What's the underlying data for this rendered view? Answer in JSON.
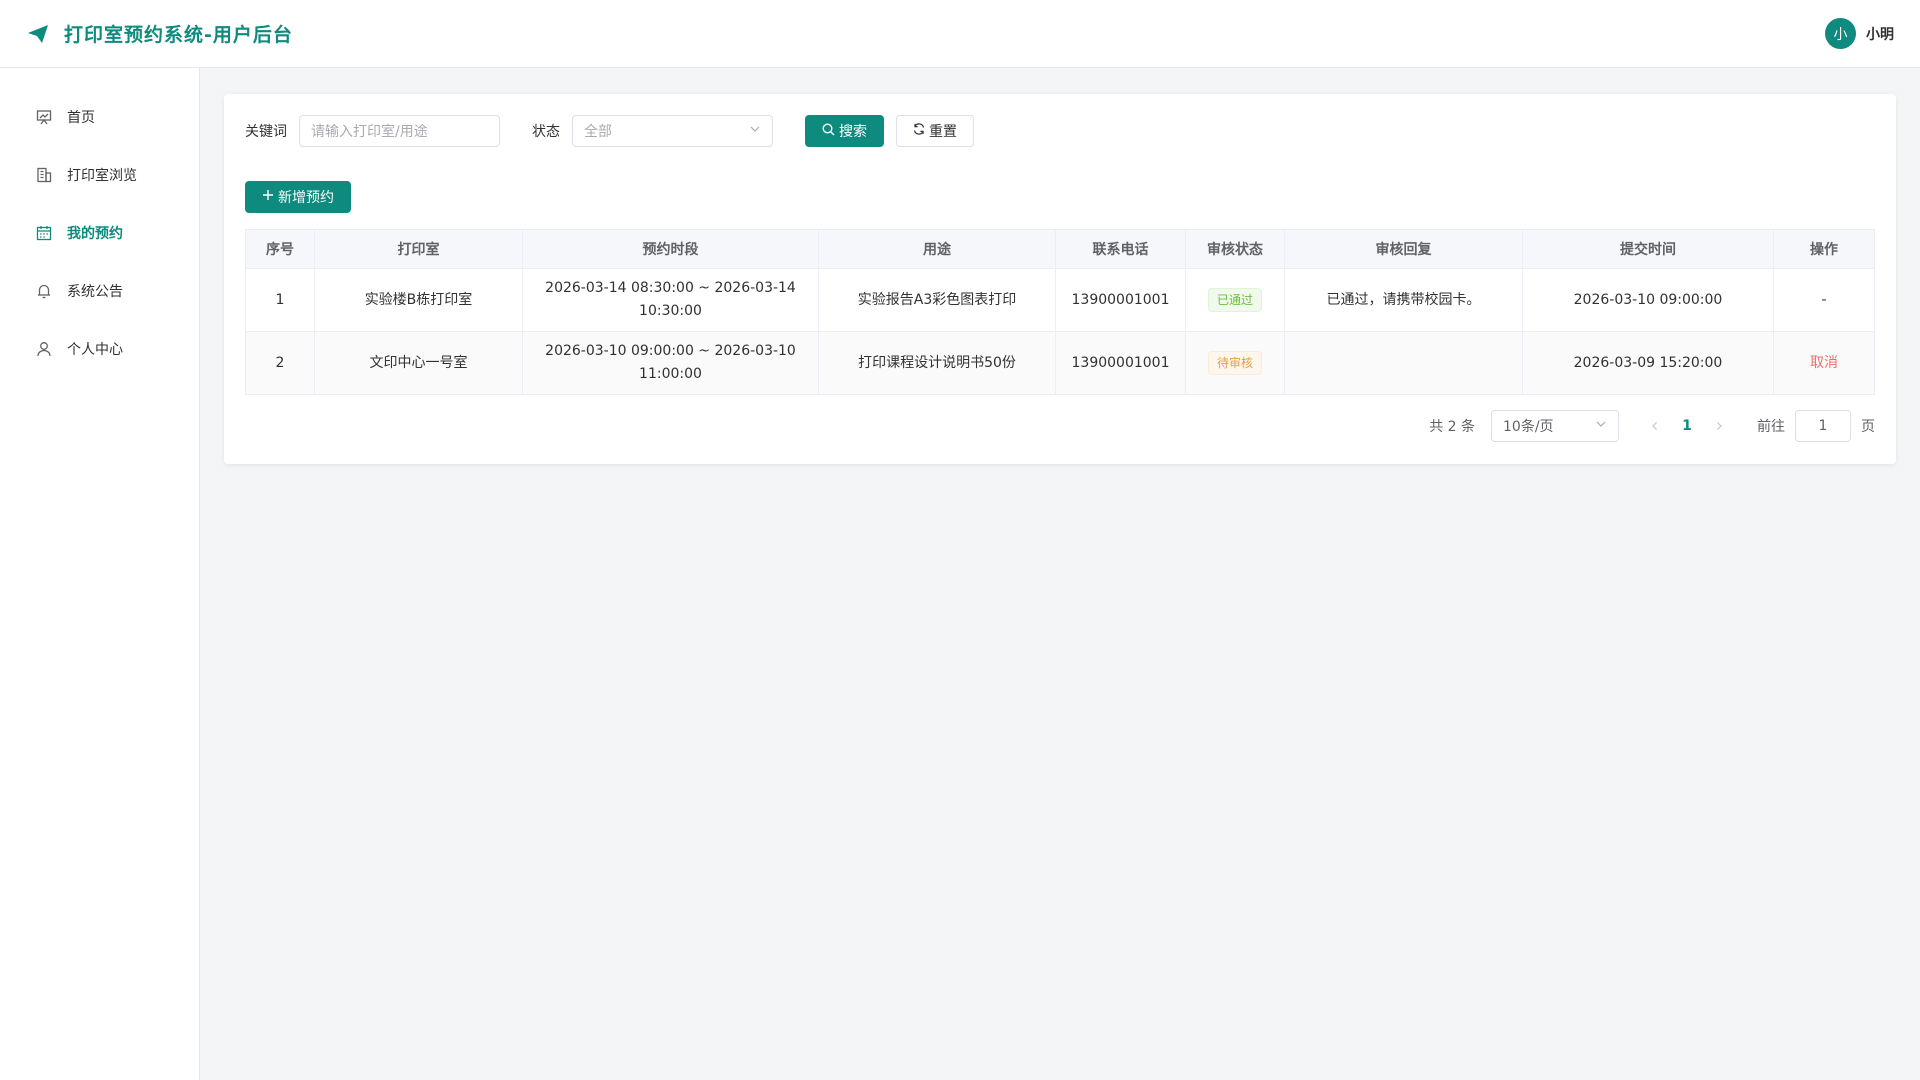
{
  "header": {
    "title": "打印室预约系统-用户后台",
    "avatar_text": "小",
    "username": "小明"
  },
  "sidebar": {
    "items": [
      {
        "label": "首页",
        "icon": "dashboard-icon",
        "active": false
      },
      {
        "label": "打印室浏览",
        "icon": "building-icon",
        "active": false
      },
      {
        "label": "我的预约",
        "icon": "calendar-icon",
        "active": true
      },
      {
        "label": "系统公告",
        "icon": "bell-icon",
        "active": false
      },
      {
        "label": "个人中心",
        "icon": "user-icon",
        "active": false
      }
    ]
  },
  "filters": {
    "keyword_label": "关键词",
    "keyword_placeholder": "请输入打印室/用途",
    "status_label": "状态",
    "status_value": "全部",
    "search_label": "搜索",
    "reset_label": "重置"
  },
  "add_button_label": "新增预约",
  "table": {
    "headers": [
      "序号",
      "打印室",
      "预约时段",
      "用途",
      "联系电话",
      "审核状态",
      "审核回复",
      "提交时间",
      "操作"
    ],
    "rows": [
      {
        "index": "1",
        "room": "实验楼B栋打印室",
        "period_line1": "2026-03-14 08:30:00 ~ 2026-03-14",
        "period_line2": "10:30:00",
        "purpose": "实验报告A3彩色图表打印",
        "phone": "13900001001",
        "status": "已通过",
        "reply": "已通过，请携带校园卡。",
        "submitted": "2026-03-10 09:00:00",
        "action": "-"
      },
      {
        "index": "2",
        "room": "文印中心一号室",
        "period_line1": "2026-03-10 09:00:00 ~ 2026-03-10",
        "period_line2": "11:00:00",
        "purpose": "打印课程设计说明书50份",
        "phone": "13900001001",
        "status": "待审核",
        "reply": "",
        "submitted": "2026-03-09 15:20:00",
        "action": "取消"
      }
    ]
  },
  "pagination": {
    "total_text": "共 2 条",
    "page_size": "10条/页",
    "current_page": "1",
    "goto_label": "前往",
    "goto_value": "1",
    "page_suffix": "页"
  },
  "colors": {
    "primary": "#0f8a7e",
    "success": "#67c23a",
    "warning": "#e6a23c",
    "danger": "#f56c6c"
  }
}
